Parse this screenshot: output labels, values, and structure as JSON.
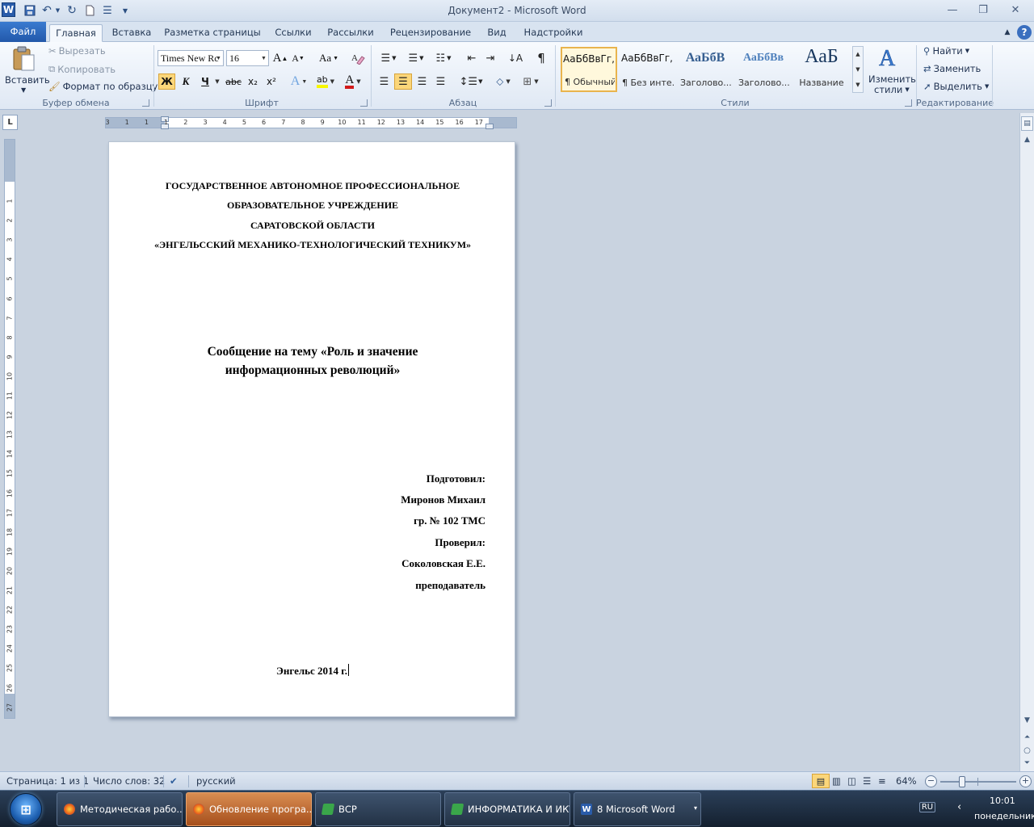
{
  "window": {
    "title": "Документ2 - Microsoft Word",
    "logo_letter": "W",
    "controls": {
      "minimize": "—",
      "restore": "❐",
      "close": "✕"
    }
  },
  "tabs": [
    {
      "label": "Файл"
    },
    {
      "label": "Главная"
    },
    {
      "label": "Вставка"
    },
    {
      "label": "Разметка страницы"
    },
    {
      "label": "Ссылки"
    },
    {
      "label": "Рассылки"
    },
    {
      "label": "Рецензирование"
    },
    {
      "label": "Вид"
    },
    {
      "label": "Надстройки"
    }
  ],
  "ribbon": {
    "clipboard": {
      "group_label": "Буфер обмена",
      "paste_label": "Вставить",
      "cut_label": "Вырезать",
      "copy_label": "Копировать",
      "format_painter_label": "Формат по образцу"
    },
    "font": {
      "group_label": "Шрифт",
      "font_name": "Times New Rc",
      "font_size": "16",
      "bold_glyph": "Ж",
      "italic_glyph": "К",
      "underline_glyph": "Ч",
      "strike_glyph": "abc",
      "subscript_glyph": "x₂",
      "superscript_glyph": "x²",
      "grow_glyph": "A",
      "shrink_glyph": "A",
      "case_glyph": "Aa",
      "effects_glyph": "A",
      "highlight_glyph": "ab",
      "font_color_glyph": "A",
      "colors": {
        "highlight": "#f7f700",
        "font_color": "#d11a1a"
      }
    },
    "paragraph": {
      "group_label": "Абзац",
      "pilcrow": "¶"
    },
    "styles": {
      "group_label": "Стили",
      "items": [
        {
          "preview": "АаБбВвГг,",
          "name": "¶ Обычный"
        },
        {
          "preview": "АаБбВвГг,",
          "name": "¶ Без инте..."
        },
        {
          "preview": "АаБбВ",
          "name": "Заголово..."
        },
        {
          "preview": "АаБбВв",
          "name": "Заголово..."
        },
        {
          "preview": "АаБ",
          "name": "Название"
        }
      ],
      "change_styles_label_1": "Изменить",
      "change_styles_label_2": "стили"
    },
    "editing": {
      "group_label": "Редактирование",
      "find_label": "Найти",
      "replace_label": "Заменить",
      "select_label": "Выделить"
    }
  },
  "ruler": {
    "corner_glyph": "L",
    "h_numbers": [
      "3",
      "1",
      "1",
      "1",
      "2",
      "3",
      "4",
      "5",
      "6",
      "7",
      "8",
      "9",
      "10",
      "11",
      "12",
      "13",
      "14",
      "15",
      "16",
      "17"
    ],
    "v_numbers": [
      "1",
      "2",
      "3",
      "4",
      "5",
      "6",
      "7",
      "8",
      "9",
      "10",
      "11",
      "12",
      "13",
      "14",
      "15",
      "16",
      "17",
      "18",
      "19",
      "20",
      "21",
      "22",
      "23",
      "24",
      "25",
      "26",
      "27"
    ]
  },
  "document": {
    "heading_lines": [
      "ГОСУДАРСТВЕННОЕ АВТОНОМНОЕ ПРОФЕССИОНАЛЬНОЕ",
      "ОБРАЗОВАТЕЛЬНОЕ УЧРЕЖДЕНИЕ",
      "САРАТОВСКОЙ ОБЛАСТИ",
      "«ЭНГЕЛЬССКИЙ МЕХАНИКО-ТЕХНОЛОГИЧЕСКИЙ ТЕХНИКУМ»"
    ],
    "topic_lines": [
      "Сообщение на тему «Роль и значение",
      "информационных революций»"
    ],
    "signature_lines": [
      "Подготовил:",
      "Миронов Михаил",
      "гр. № 102 ТМС",
      "Проверил:",
      "Соколовская Е.Е.",
      "преподаватель"
    ],
    "footer": "Энгельс 2014 г."
  },
  "status": {
    "page": "Страница: 1 из 1",
    "words": "Число слов: 32",
    "language": "русский",
    "zoom": "64%",
    "zoom_level_percent": 64
  },
  "taskbar": {
    "tasks": [
      {
        "label": "Методическая рабо..."
      },
      {
        "label": "Обновление програ..."
      },
      {
        "label": "ВСР"
      },
      {
        "label": "ИНФОРМАТИКА И ИКТ"
      },
      {
        "label": "8 Microsoft Word"
      }
    ],
    "language": "RU",
    "time": "10:01",
    "day": "понедельник"
  }
}
